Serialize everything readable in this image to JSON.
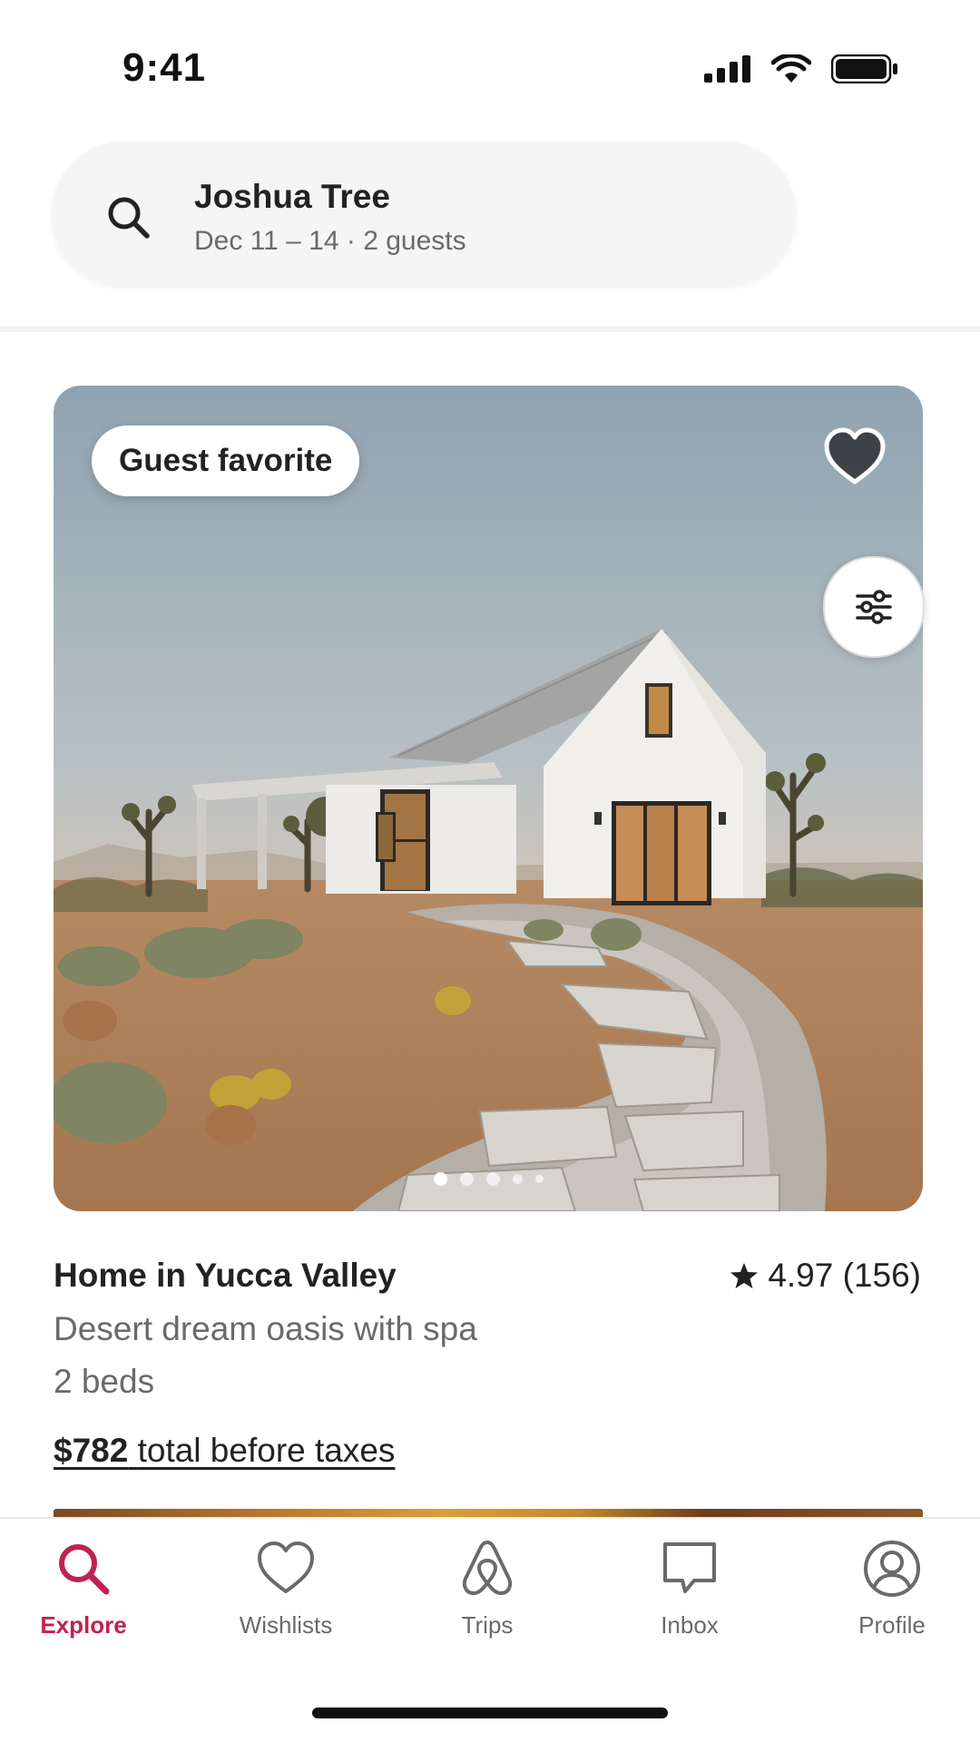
{
  "status_bar": {
    "time": "9:41",
    "icons": [
      "signal-icon",
      "wifi-icon",
      "battery-icon"
    ]
  },
  "search": {
    "icon": "search-icon",
    "location": "Joshua Tree",
    "details": "Dec 11 – 14 · 2 guests"
  },
  "listing": {
    "badge": "Guest favorite",
    "wishlist_icon": "heart-icon",
    "filter_icon": "sliders-icon",
    "photo_count": 5,
    "active_photo": 1,
    "title": "Home in Yucca Valley",
    "rating_icon": "star-icon",
    "rating": "4.97 (156)",
    "description": "Desert dream oasis with spa",
    "beds": "2 beds",
    "price_amount": "$782",
    "price_suffix": "total before taxes"
  },
  "bottom_nav": {
    "items": [
      {
        "label": "Explore",
        "icon": "search-icon",
        "active": true
      },
      {
        "label": "Wishlists",
        "icon": "heart-outline-icon",
        "active": false
      },
      {
        "label": "Trips",
        "icon": "airbnb-logo-icon",
        "active": false
      },
      {
        "label": "Inbox",
        "icon": "message-icon",
        "active": false
      },
      {
        "label": "Profile",
        "icon": "profile-icon",
        "active": false
      }
    ]
  },
  "colors": {
    "accent": "#c1224f",
    "text_primary": "#222222",
    "text_secondary": "#6a6a6a",
    "search_bg": "#f5f5f5"
  }
}
